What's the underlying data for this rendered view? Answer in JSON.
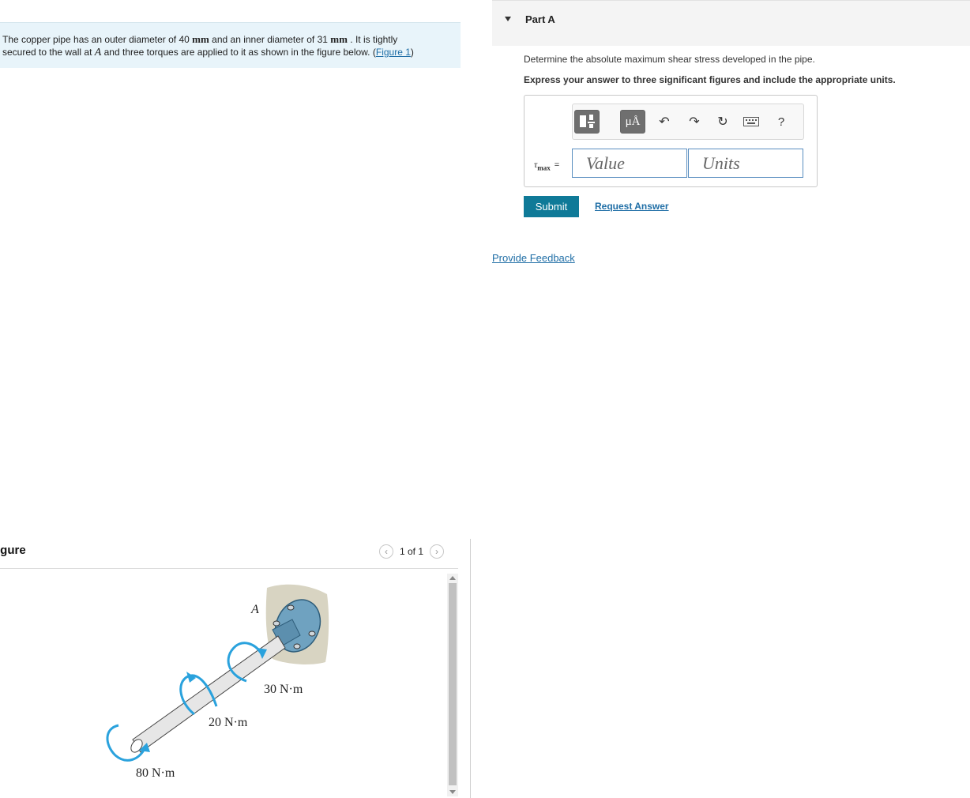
{
  "problem": {
    "text_1": "The copper pipe has an outer diameter of 40 ",
    "unit_1": "mm",
    "text_2": " and an inner diameter of 31 ",
    "unit_2": "mm",
    "text_3": " . It is tightly",
    "text_4": "secured to the wall at ",
    "point": "A",
    "text_5": " and three torques are applied to it as shown in the figure below. (",
    "figure_link": "Figure 1",
    "text_6": ")"
  },
  "figure": {
    "title": "igure",
    "pager": "1 of 1",
    "prev_icon": "chevron-left-icon",
    "next_icon": "chevron-right-icon",
    "label_A": "A",
    "torque_1": "30 N·m",
    "torque_2": "20 N·m",
    "torque_3": "80 N·m",
    "colors": {
      "arrow": "#2aa2dd",
      "flange": "#6fa2c0",
      "wall": "#d8d4c2",
      "pipe": "#e6e6e6"
    }
  },
  "part": {
    "title": "Part A",
    "question": "Determine the absolute maximum shear stress developed in the pipe.",
    "instruction": "Express your answer to three significant figures and include the appropriate units.",
    "variable": "τ",
    "variable_sub": "max",
    "equals": "=",
    "value_placeholder": "Value",
    "units_placeholder": "Units",
    "toolbar": {
      "mu_label": "μÅ",
      "help_label": "?",
      "icons": [
        "templates-icon",
        "units-icon",
        "undo-icon",
        "redo-icon",
        "reset-icon",
        "keyboard-icon",
        "help-icon"
      ]
    },
    "submit_label": "Submit",
    "request_label": "Request Answer"
  },
  "feedback_label": "Provide Feedback",
  "colors": {
    "link": "#1f6ea6",
    "submit_bg": "#0f7a98",
    "problem_bg": "#e8f4fa"
  }
}
